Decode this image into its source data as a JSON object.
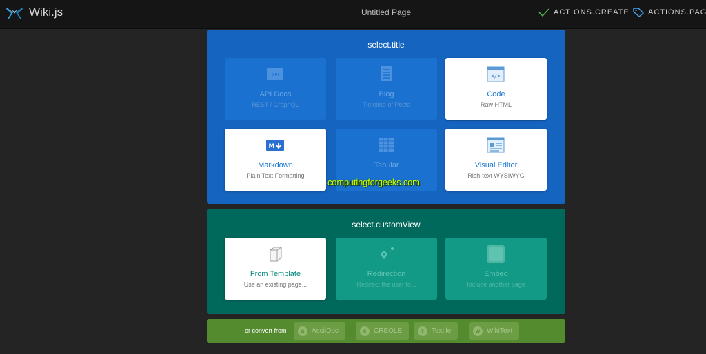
{
  "header": {
    "app_title": "Wiki.js",
    "page_title": "Untitled Page",
    "actions": [
      {
        "label": "ACTIONS.CREATE",
        "icon": "check-icon"
      },
      {
        "label": "ACTIONS.PAGE",
        "icon": "tag-icon"
      }
    ]
  },
  "select_title": {
    "heading": "select.title",
    "cards": [
      {
        "label": "API Docs",
        "sub": "REST / GraphQL",
        "icon": "api-icon"
      },
      {
        "label": "Blog",
        "sub": "Timeline of Posts",
        "icon": "blog-icon"
      },
      {
        "label": "Code",
        "sub": "Raw HTML",
        "icon": "code-icon"
      },
      {
        "label": "Markdown",
        "sub": "Plain Text Formatting",
        "icon": "markdown-icon"
      },
      {
        "label": "Tabular",
        "sub": "",
        "icon": "table-icon"
      },
      {
        "label": "Visual Editor",
        "sub": "Rich-text WYSIWYG",
        "icon": "visual-editor-icon"
      }
    ]
  },
  "custom_view": {
    "heading": "select.customView",
    "cards": [
      {
        "label": "From Template",
        "sub": "Use an existing page...",
        "icon": "cube-icon"
      },
      {
        "label": "Redirection",
        "sub": "Redirect the user to...",
        "icon": "redirect-icon"
      },
      {
        "label": "Embed",
        "sub": "Include another page",
        "icon": "embed-icon"
      }
    ]
  },
  "convert": {
    "label": "or convert from",
    "options": [
      {
        "label": "AsciiDoc",
        "badge": "a"
      },
      {
        "label": "CREOLE",
        "badge": "c"
      },
      {
        "label": "Textile",
        "badge": "t"
      },
      {
        "label": "WikiText",
        "badge": "w"
      }
    ]
  },
  "watermark": "computingforgeeks.com",
  "colors": {
    "blue_panel": "#1565c0",
    "green_panel": "#00695c",
    "lime_panel": "#558b2f",
    "accent": "#1976d2"
  }
}
